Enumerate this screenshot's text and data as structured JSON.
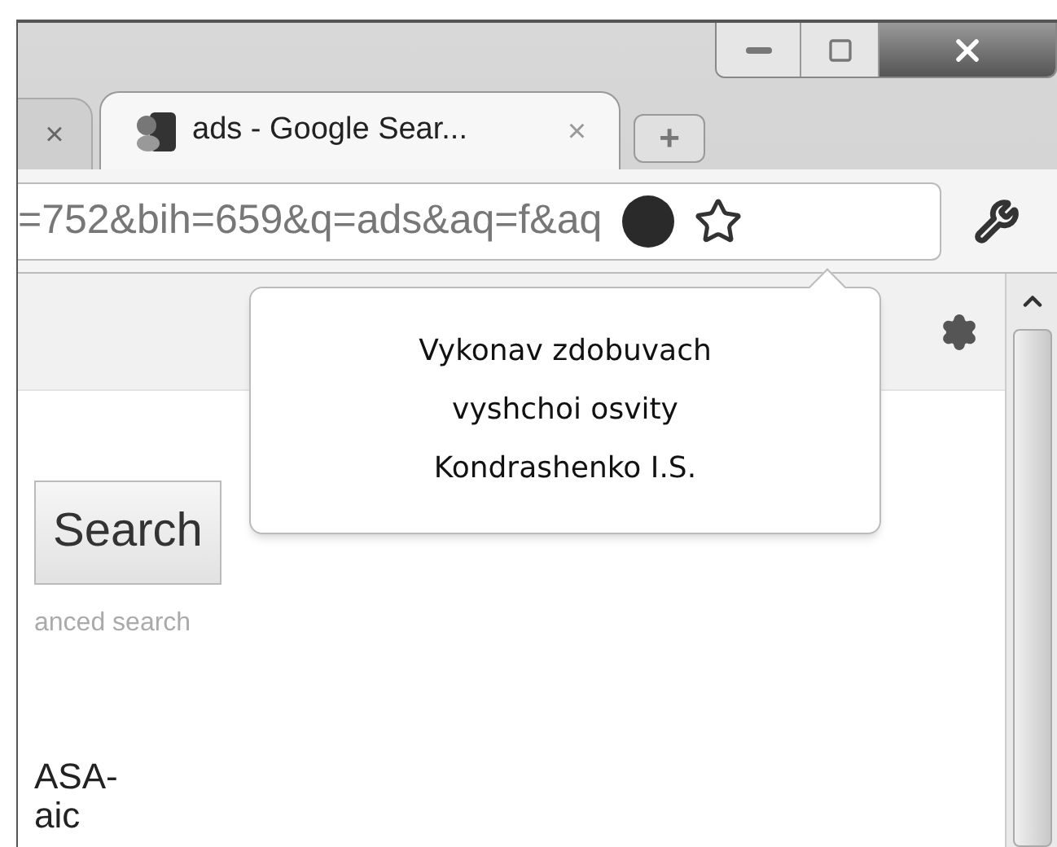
{
  "tabs": [
    {
      "selected": false,
      "close": "×"
    },
    {
      "title": "ads - Google Sear...",
      "selected": true,
      "close": "×"
    }
  ],
  "new_tab": "+",
  "address_bar": {
    "value": "=752&bih=659&q=ads&aq=f&aq",
    "bookmarked": false
  },
  "tooltip": {
    "lines": [
      "Vykonav zdobuvach",
      "vyshchoi osvity",
      "Kondrashenko I.S."
    ]
  },
  "page": {
    "search_button": "Search",
    "advanced_link": "anced search",
    "result_lines": [
      "ASA-",
      "aic"
    ]
  }
}
